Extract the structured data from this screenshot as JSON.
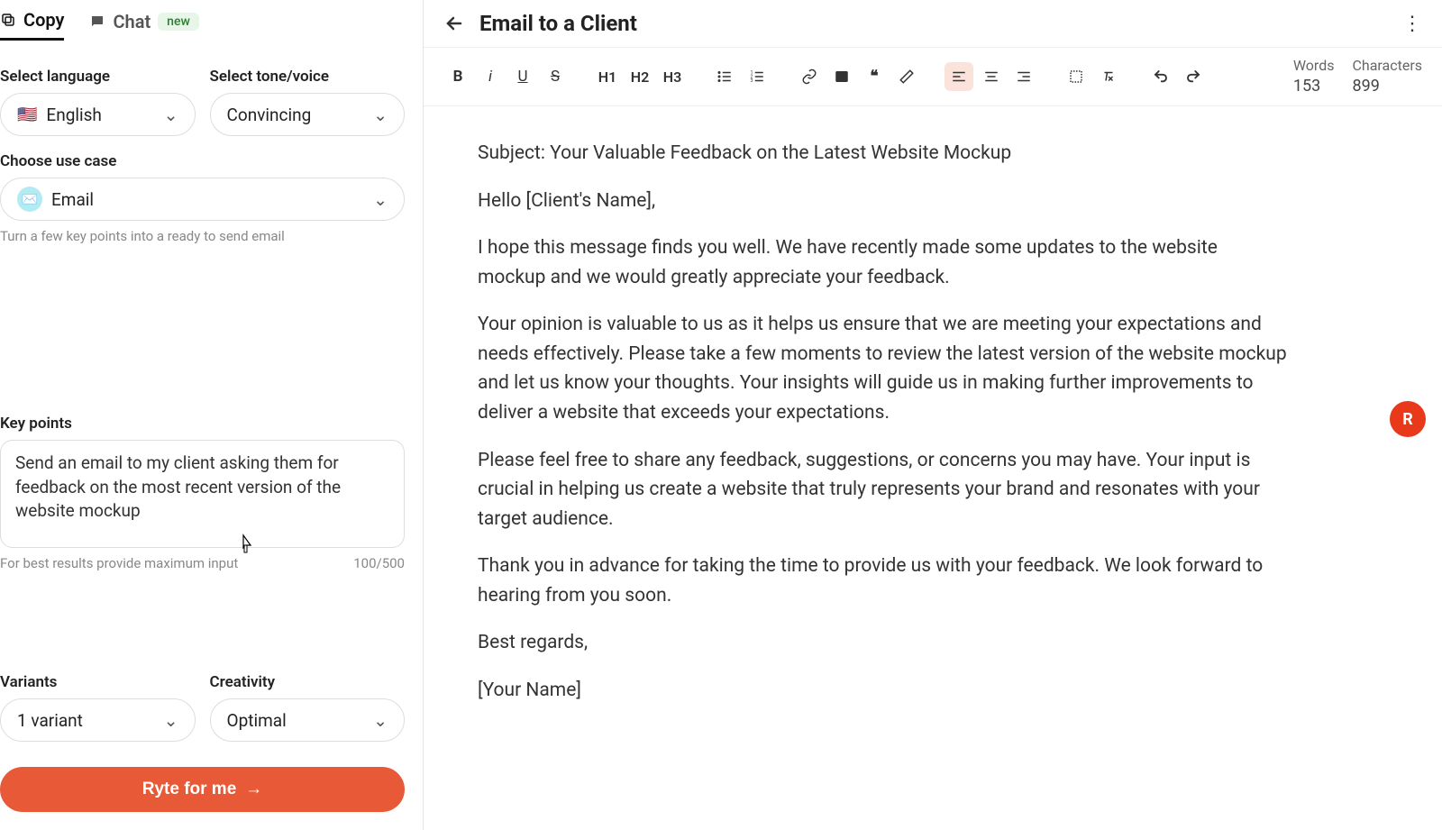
{
  "tabs": {
    "copy": "Copy",
    "chat": "Chat",
    "new_badge": "new"
  },
  "form": {
    "language_label": "Select language",
    "language_value": "English",
    "tone_label": "Select tone/voice",
    "tone_value": "Convincing",
    "usecase_label": "Choose use case",
    "usecase_value": "Email",
    "usecase_helper": "Turn a few key points into a ready to send email",
    "keypoints_label": "Key points",
    "keypoints_value": "Send an email to my client asking them for feedback on the most recent version of the website mockup",
    "keypoints_helper": "For best results provide maximum input",
    "keypoints_count": "100/500",
    "variants_label": "Variants",
    "variants_value": "1 variant",
    "creativity_label": "Creativity",
    "creativity_value": "Optimal",
    "submit_label": "Ryte for me"
  },
  "header": {
    "title": "Email to a Client"
  },
  "toolbar": {
    "h1": "H1",
    "h2": "H2",
    "h3": "H3",
    "words_label": "Words",
    "words_value": "153",
    "chars_label": "Characters",
    "chars_value": "899"
  },
  "document": {
    "p1": "Subject: Your Valuable Feedback on the Latest Website Mockup",
    "p2": "Hello [Client's Name],",
    "p3": "I hope this message finds you well. We have recently made some updates to the website mockup and we would greatly appreciate your feedback.",
    "p4": "Your opinion is valuable to us as it helps us ensure that we are meeting your expectations and needs effectively. Please take a few moments to review the latest version of the website mockup and let us know your thoughts. Your insights will guide us in making further improvements to deliver a website that exceeds your expectations.",
    "p5": "Please feel free to share any feedback, suggestions, or concerns you may have. Your input is crucial in helping us create a website that truly represents your brand and resonates with your target audience.",
    "p6": "Thank you in advance for taking the time to provide us with your feedback. We look forward to hearing from you soon.",
    "p7": "Best regards,",
    "p8": "[Your Name]"
  },
  "fab": "R"
}
